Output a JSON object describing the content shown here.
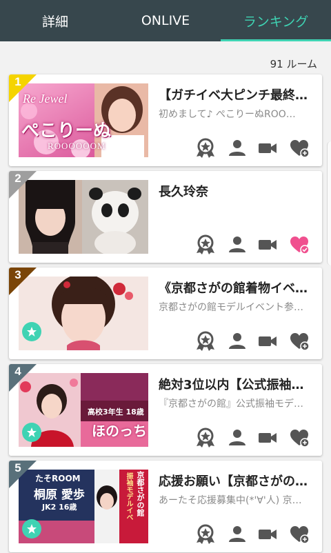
{
  "tabs": [
    {
      "label": "詳細",
      "active": false
    },
    {
      "label": "ONLIVE",
      "active": false
    },
    {
      "label": "ランキング",
      "active": true
    }
  ],
  "room_count": "91 ルーム",
  "colors": {
    "header_bg": "#37474d",
    "accent": "#3fd3b3",
    "rank_gold": "#f5d400",
    "rank_silver": "#9e9e9e",
    "rank_bronze": "#7a4508",
    "rank_other": "#59707a",
    "heart_pink": "#f0508f",
    "icon_gray": "#555555"
  },
  "rooms": [
    {
      "rank": "1",
      "title": "【ガチイベ大ピンチ最終…",
      "subtitle": "初めまして♪ ぺこりーぬROO…",
      "favorited": false,
      "thumb_text": [
        "Re Jewel",
        "ぺこりーぬ",
        "ROOOOOOM"
      ]
    },
    {
      "rank": "2",
      "title": "長久玲奈",
      "subtitle": "",
      "favorited": true,
      "thumb_text": []
    },
    {
      "rank": "3",
      "title": "《京都さがの館着物イベ…",
      "subtitle": "京都さがの館モデルイベント参…",
      "favorited": false,
      "thumb_text": []
    },
    {
      "rank": "4",
      "title": "絶対3位以内【公式振袖…",
      "subtitle": "『京都さがの館』公式振袖モデ…",
      "favorited": false,
      "thumb_text": [
        "高校3年生 18歳",
        "ほのっち"
      ]
    },
    {
      "rank": "5",
      "title": "応援お願い【京都さがの…",
      "subtitle": "あーたそ応援募集中(*'∀'人) 京…",
      "favorited": false,
      "thumb_text": [
        "たそROOM",
        "桐原 愛歩",
        "JK2 16歳",
        "京都さがの館",
        "振袖モデルイベ"
      ]
    }
  ]
}
